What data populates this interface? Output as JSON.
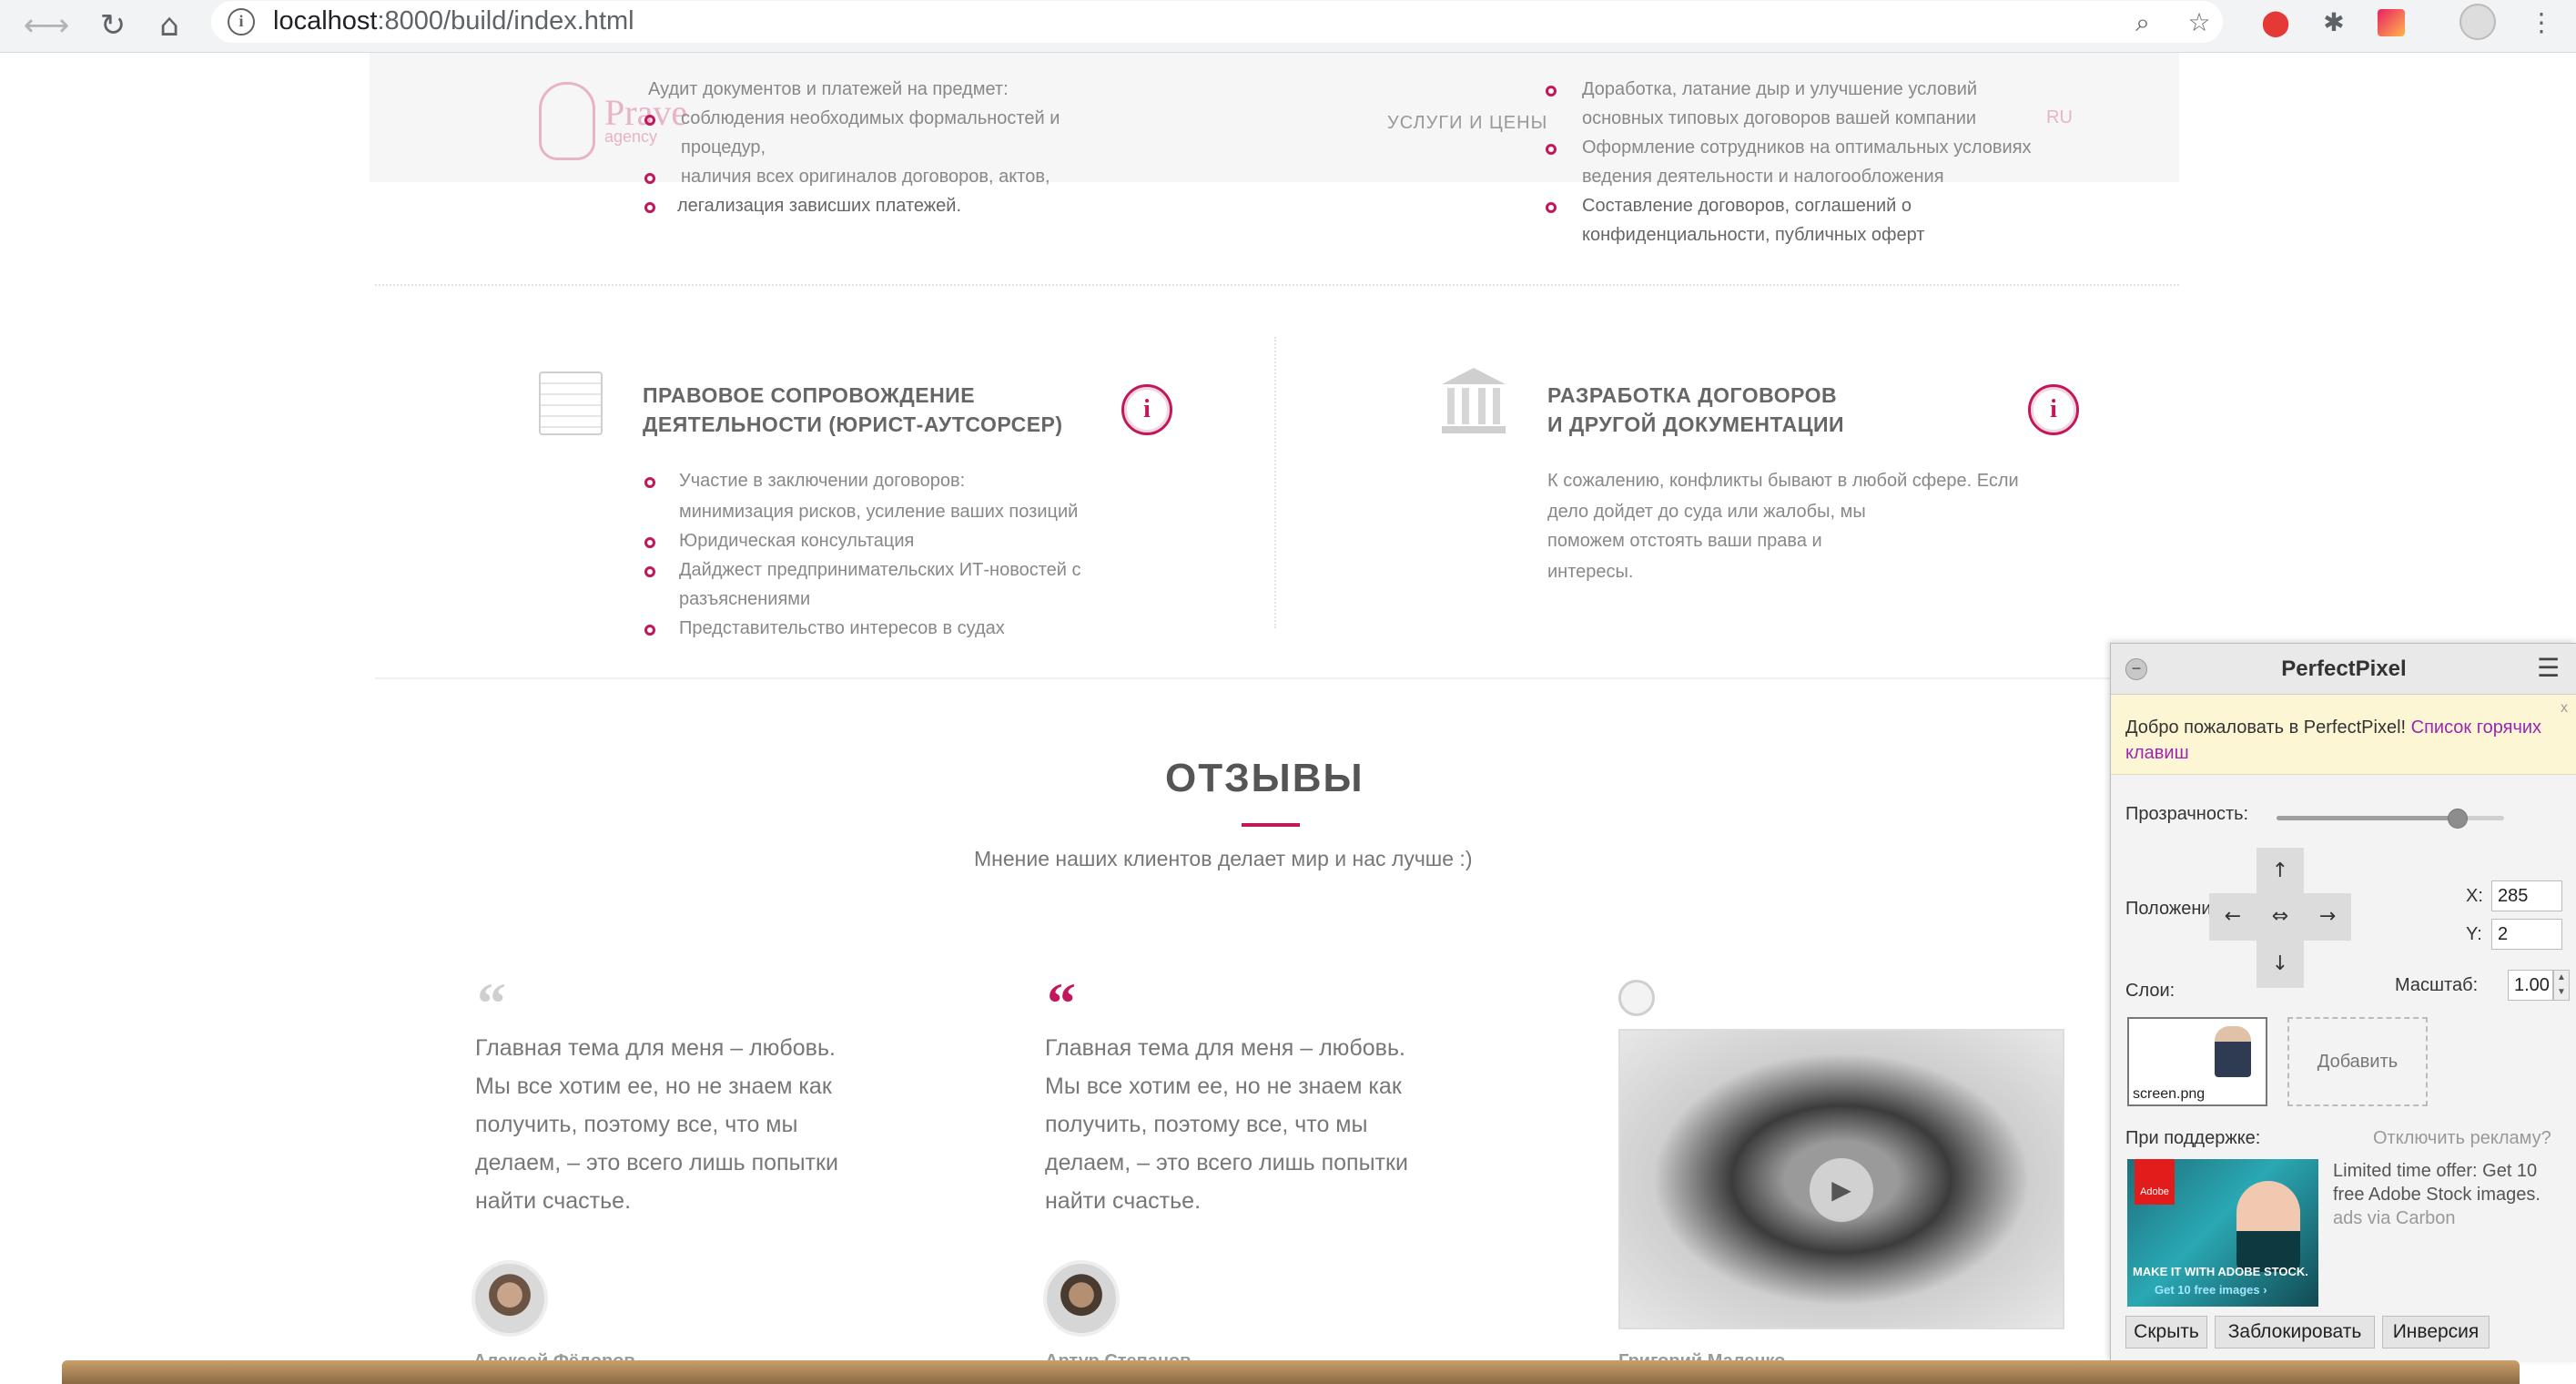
{
  "browser": {
    "url_host": "localhost",
    "url_rest": ":8000/build/index.html"
  },
  "header": {
    "logo_text": "Prave",
    "logo_sub": "agency",
    "nav_item": "УСЛУГИ И ЦЕНЫ",
    "lang": "RU"
  },
  "top_left": {
    "intro": "Аудит документов и платежей на предмет:",
    "items": [
      "соблюдения необходимых формальностей и",
      "процедур,",
      "наличия всех оригиналов договоров, актов,",
      "легализация зависших платежей."
    ]
  },
  "top_right": {
    "items": [
      "Доработка, латание дыр и улучшение условий",
      "основных типовых договоров вашей компании",
      "Оформление сотрудников на оптимальных условиях",
      "ведения деятельности и налогообложения",
      "Составление договоров, соглашений о",
      "конфиденциальности, публичных оферт"
    ]
  },
  "service_left": {
    "title_line1": "ПРАВОВОЕ СОПРОВОЖДЕНИЕ",
    "title_line2": "ДЕЯТЕЛЬНОСТИ (ЮРИСТ-АУТСОРСЕР)",
    "info": "i",
    "items": [
      "Участие в заключении договоров:",
      "минимизация рисков, усиление ваших позиций",
      "Юридическая консультация",
      "Дайджест предпринимательских ИТ-новостей с",
      "разъяснениями",
      "Представительство интересов в судах"
    ]
  },
  "service_right": {
    "title_line1": "РАЗРАБОТКА ДОГОВОРОВ",
    "title_line2": "И ДРУГОЙ ДОКУМЕНТАЦИИ",
    "info": "i",
    "text_lines": [
      "К сожалению, конфликты бывают в любой сфере. Если",
      "дело дойдет до суда или жалобы, мы",
      "поможем отстоять ваши права и",
      "интересы."
    ]
  },
  "reviews": {
    "heading": "ОТЗЫВЫ",
    "subtitle": "Мнение наших клиентов делает мир и нас лучше :)",
    "review_lines": [
      "Главная тема для меня – любовь.",
      "Мы все хотим ее, но не знаем как",
      "получить, поэтому все, что мы",
      "делаем, – это всего лишь попытки",
      "найти счастье."
    ],
    "names": [
      "Алексей Фёдоров",
      "Артур Степанов",
      "Григорий Маленко"
    ]
  },
  "perfectpixel": {
    "title": "PerfectPixel",
    "welcome": "Добро пожаловать в PerfectPixel!",
    "welcome_link": "Список горячих клавиш",
    "close": "x",
    "opacity_label": "Прозрачность:",
    "opacity": 0.78,
    "position_label": "Положение:",
    "x_label": "X:",
    "x_value": "285",
    "y_label": "Y:",
    "y_value": "2",
    "scale_label": "Масштаб:",
    "scale_value": "1.00",
    "layers_label": "Слои:",
    "layer_file": "screen.png",
    "add_label": "Добавить",
    "support_label": "При поддержке:",
    "disable_ads": "Отключить рекламу?",
    "ad_text": "Limited time offer: Get 10 free Adobe Stock images.",
    "ad_via": "ads via Carbon",
    "ad_banner_line1": "MAKE IT WITH ADOBE STOCK.",
    "ad_banner_line2": "Get 10 free images ›",
    "ad_brand": "Adobe",
    "btn_hide": "Скрыть",
    "btn_lock": "Заблокировать",
    "btn_invert": "Инверсия"
  },
  "colors": {
    "accent": "#c2185b",
    "panel_bg": "#f3f3f3",
    "welcome_bg": "#fdf6d4"
  },
  "icons": [
    "back-icon",
    "forward-icon",
    "reload-icon",
    "home-icon",
    "info-icon",
    "zoom-icon",
    "star-icon",
    "extension-icon",
    "profile-icon",
    "menu-icon",
    "quote-icon",
    "play-icon"
  ]
}
